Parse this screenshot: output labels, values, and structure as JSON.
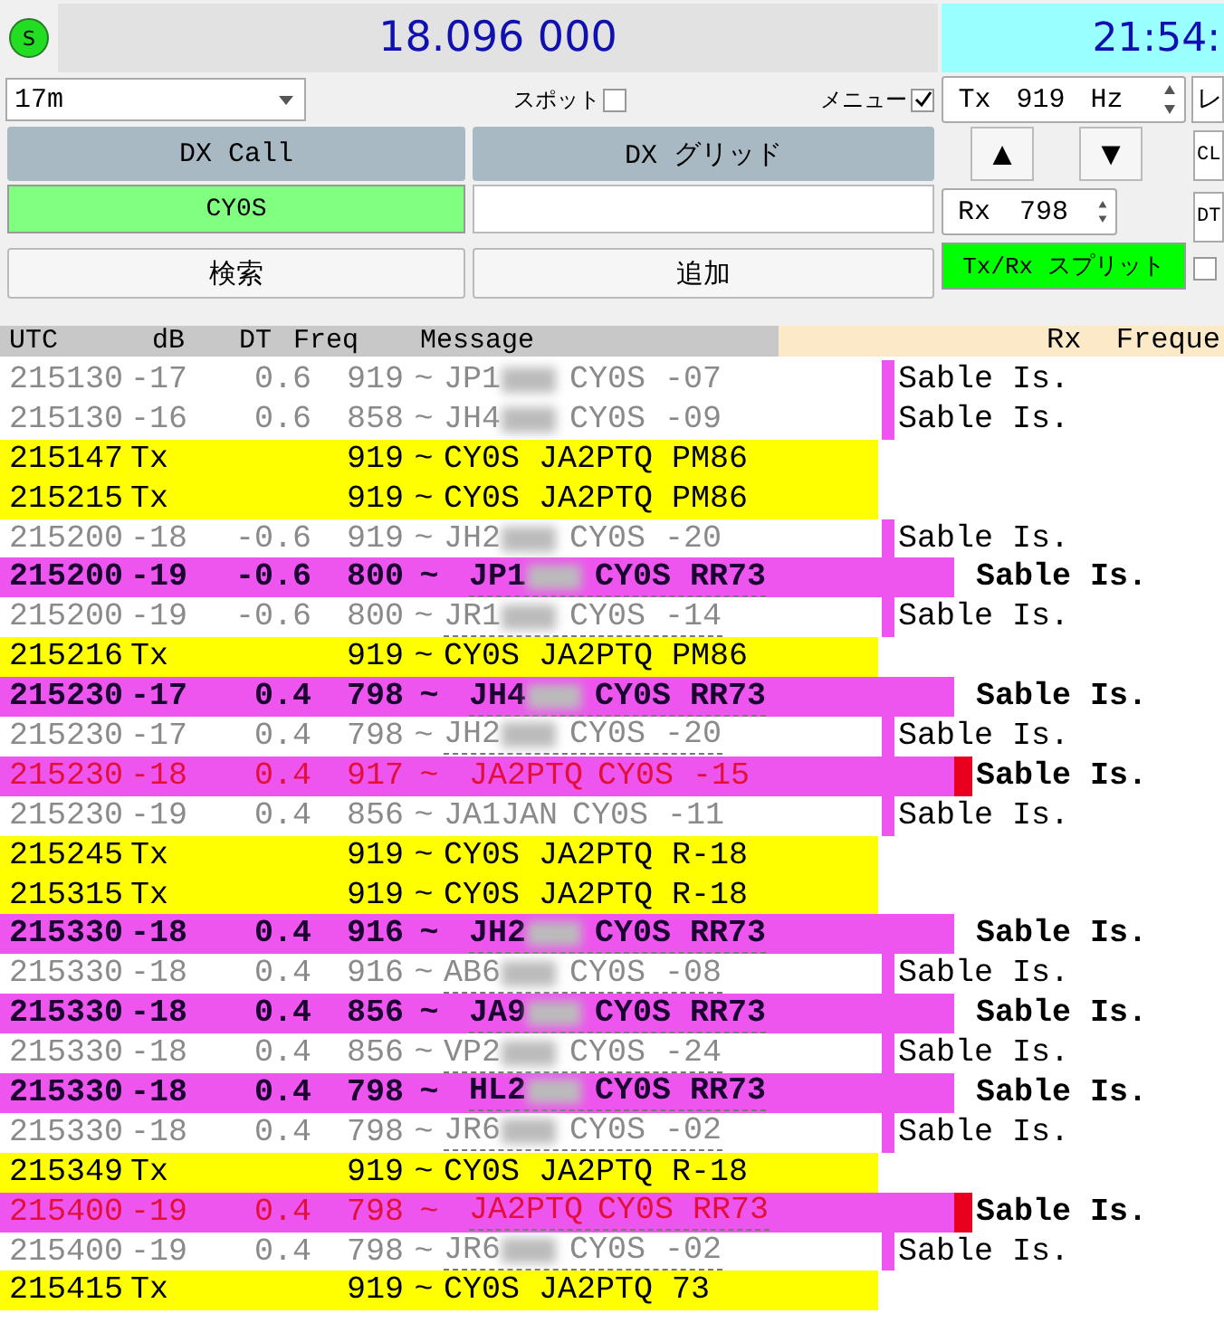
{
  "status_led": {
    "label": "S",
    "on": true
  },
  "frequency_display": "18.096 000",
  "clock": "21:54:",
  "band": {
    "value": "17m"
  },
  "spot_checkbox": {
    "label": "スポット",
    "checked": false
  },
  "menu_checkbox": {
    "label": "メニュー",
    "checked": true
  },
  "tx_freq": {
    "label": "Tx",
    "value": "919",
    "unit": "Hz"
  },
  "rx_freq": {
    "label": "Rx",
    "value": "798"
  },
  "dx_call": {
    "header": "DX Call",
    "value": "CY0S"
  },
  "dx_grid": {
    "header": "DX グリッド"
  },
  "up_button": "▲",
  "down_button": "▼",
  "split_button": {
    "label": "Tx/Rx スプリット",
    "on": true
  },
  "search_button": "検索",
  "add_button": "追加",
  "right_edge": {
    "report": "レ",
    "cl": "CL",
    "dt": "DT",
    "split_check": false
  },
  "columns": [
    "UTC",
    "dB",
    "DT",
    "Freq",
    "Message"
  ],
  "rx_header": "Rx  Freque",
  "rows": [
    {
      "kind": "decode",
      "utc": "215130",
      "db": "-17",
      "dt": "0.6",
      "freq": "919",
      "sep": "~",
      "call": "JP1",
      "redacted": true,
      "message": "CY0S -07",
      "underlined": false,
      "country": "Sable Is."
    },
    {
      "kind": "decode",
      "utc": "215130",
      "db": "-16",
      "dt": "0.6",
      "freq": "858",
      "sep": "~",
      "call": "JH4",
      "redacted": true,
      "message": "CY0S -09",
      "underlined": false,
      "country": "Sable Is."
    },
    {
      "kind": "tx",
      "utc": "215147",
      "db": "Tx",
      "freq": "919",
      "sep": "~",
      "message": "CY0S JA2PTQ PM86",
      "redacted": false,
      "underlined": false
    },
    {
      "kind": "tx",
      "utc": "215215",
      "db": "Tx",
      "freq": "919",
      "sep": "~",
      "message": "CY0S JA2PTQ PM86",
      "redacted": false,
      "underlined": false
    },
    {
      "kind": "decode",
      "utc": "215200",
      "db": "-18",
      "dt": "-0.6",
      "freq": "919",
      "sep": "~",
      "call": "JH2",
      "redacted": true,
      "message": "CY0S -20",
      "underlined": false,
      "country": "Sable Is."
    },
    {
      "kind": "rr73",
      "utc": "215200",
      "db": "-19",
      "dt": "-0.6",
      "freq": "800",
      "sep": "~",
      "call": "JP1",
      "redacted": true,
      "message": "CY0S RR73",
      "underlined": true,
      "country": "Sable Is."
    },
    {
      "kind": "decode",
      "utc": "215200",
      "db": "-19",
      "dt": "-0.6",
      "freq": "800",
      "sep": "~",
      "call": "JR1",
      "redacted": true,
      "message": "CY0S -14",
      "underlined": true,
      "country": "Sable Is."
    },
    {
      "kind": "tx",
      "utc": "215216",
      "db": "Tx",
      "freq": "919",
      "sep": "~",
      "message": "CY0S JA2PTQ PM86",
      "redacted": false,
      "underlined": false
    },
    {
      "kind": "rr73",
      "utc": "215230",
      "db": "-17",
      "dt": "0.4",
      "freq": "798",
      "sep": "~",
      "call": "JH4",
      "redacted": true,
      "message": "CY0S RR73",
      "underlined": true,
      "country": "Sable Is."
    },
    {
      "kind": "decode",
      "utc": "215230",
      "db": "-17",
      "dt": "0.4",
      "freq": "798",
      "sep": "~",
      "call": "JH2",
      "redacted": true,
      "message": "CY0S -20",
      "underlined": true,
      "country": "Sable Is."
    },
    {
      "kind": "to_me",
      "utc": "215230",
      "db": "-18",
      "dt": "0.4",
      "freq": "917",
      "sep": "~",
      "call": "JA2PTQ",
      "redacted": false,
      "message": "CY0S -15",
      "underlined": false,
      "country": "Sable Is."
    },
    {
      "kind": "decode",
      "utc": "215230",
      "db": "-19",
      "dt": "0.4",
      "freq": "856",
      "sep": "~",
      "call": "JA1JAN",
      "redacted": false,
      "message": "CY0S -11",
      "underlined": false,
      "country": "Sable Is."
    },
    {
      "kind": "tx",
      "utc": "215245",
      "db": "Tx",
      "freq": "919",
      "sep": "~",
      "message": "CY0S JA2PTQ R-18",
      "redacted": false,
      "underlined": false
    },
    {
      "kind": "tx",
      "utc": "215315",
      "db": "Tx",
      "freq": "919",
      "sep": "~",
      "message": "CY0S JA2PTQ R-18",
      "redacted": false,
      "underlined": false
    },
    {
      "kind": "rr73",
      "utc": "215330",
      "db": "-18",
      "dt": "0.4",
      "freq": "916",
      "sep": "~",
      "call": "JH2",
      "redacted": true,
      "message": "CY0S RR73",
      "underlined": true,
      "country": "Sable Is."
    },
    {
      "kind": "decode",
      "utc": "215330",
      "db": "-18",
      "dt": "0.4",
      "freq": "916",
      "sep": "~",
      "call": "AB6",
      "redacted": true,
      "message": "CY0S -08",
      "underlined": true,
      "country": "Sable Is."
    },
    {
      "kind": "rr73",
      "utc": "215330",
      "db": "-18",
      "dt": "0.4",
      "freq": "856",
      "sep": "~",
      "call": "JA9",
      "redacted": true,
      "message": "CY0S RR73",
      "underlined": true,
      "country": "Sable Is."
    },
    {
      "kind": "decode",
      "utc": "215330",
      "db": "-18",
      "dt": "0.4",
      "freq": "856",
      "sep": "~",
      "call": "VP2",
      "redacted": true,
      "message": "CY0S -24",
      "underlined": true,
      "country": "Sable Is."
    },
    {
      "kind": "rr73",
      "utc": "215330",
      "db": "-18",
      "dt": "0.4",
      "freq": "798",
      "sep": "~",
      "call": "HL2",
      "redacted": true,
      "message": "CY0S RR73",
      "underlined": true,
      "country": "Sable Is."
    },
    {
      "kind": "decode",
      "utc": "215330",
      "db": "-18",
      "dt": "0.4",
      "freq": "798",
      "sep": "~",
      "call": "JR6",
      "redacted": true,
      "message": "CY0S -02",
      "underlined": true,
      "country": "Sable Is."
    },
    {
      "kind": "tx",
      "utc": "215349",
      "db": "Tx",
      "freq": "919",
      "sep": "~",
      "message": "CY0S JA2PTQ R-18",
      "redacted": false,
      "underlined": false
    },
    {
      "kind": "to_me",
      "utc": "215400",
      "db": "-19",
      "dt": "0.4",
      "freq": "798",
      "sep": "~",
      "call": "JA2PTQ",
      "redacted": false,
      "message": "CY0S RR73",
      "underlined": true,
      "country": "Sable Is."
    },
    {
      "kind": "decode",
      "utc": "215400",
      "db": "-19",
      "dt": "0.4",
      "freq": "798",
      "sep": "~",
      "call": "JR6",
      "redacted": true,
      "message": "CY0S -02",
      "underlined": true,
      "country": "Sable Is."
    },
    {
      "kind": "tx",
      "utc": "215415",
      "db": "Tx",
      "freq": "919",
      "sep": "~",
      "message": "CY0S JA2PTQ 73",
      "redacted": false,
      "underlined": false
    }
  ]
}
